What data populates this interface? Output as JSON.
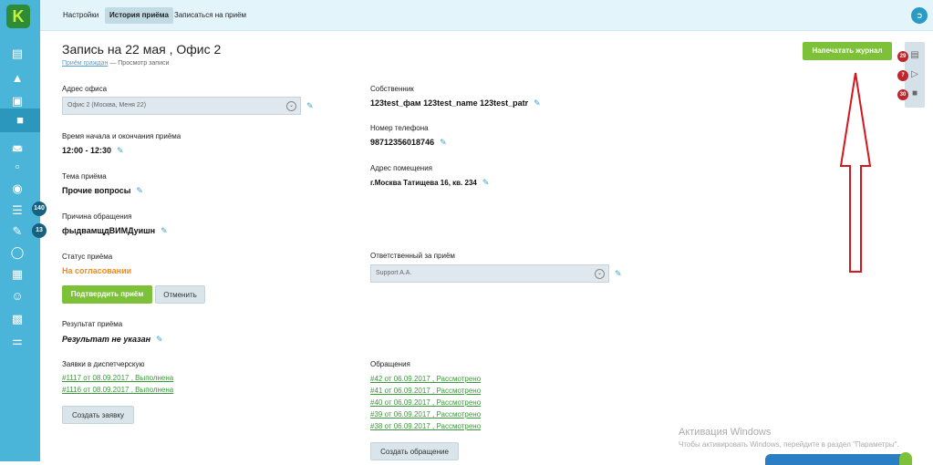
{
  "logo": "K",
  "colors": {
    "sidebar": "#4ab5d9",
    "accent_green": "#7cc137",
    "status_orange": "#f08a1e",
    "badge_red": "#c0252b"
  },
  "sidebar": {
    "icons": [
      "chart-icon",
      "landscape-icon",
      "wallet-icon",
      "stamp-icon",
      "bookmark-icon",
      "archive-icon",
      "coin-icon",
      "tray-icon",
      "edit-icon",
      "chat-icon",
      "building-icon",
      "smile-icon",
      "newspaper-icon",
      "sliders-icon"
    ],
    "badges": {
      "tray": "140",
      "edit": "13"
    }
  },
  "topnav": {
    "tabs": [
      "Настройки",
      "История приёма",
      "Записаться на приём"
    ],
    "active_tab": "История приёма"
  },
  "page": {
    "title": "Запись на 22 мая , Офис 2",
    "breadcrumb": {
      "link": "Приём граждан",
      "separator": "—",
      "current": "Просмотр записи"
    },
    "print_button": "Напечатать журнал"
  },
  "right_panel": {
    "badges": [
      "29",
      "7",
      "30"
    ]
  },
  "form": {
    "office_address_label": "Адрес офиса",
    "office_address_value": "Офис 2 (Москва, Меня 22)",
    "time_label": "Время начала и окончания приёма",
    "time_value": "12:00 - 12:30",
    "topic_label": "Тема приёма",
    "topic_value": "Прочие вопросы",
    "reason_label": "Причина обращения",
    "reason_value": "фыдвамщдВИМДуишн",
    "status_label": "Статус приёма",
    "status_value": "На согласовании",
    "confirm_button": "Подтвердить приём",
    "cancel_button": "Отменить",
    "result_label": "Результат приёма",
    "result_value": "Результат не указан",
    "owner_label": "Собственник",
    "owner_value": "123test_фам 123test_name 123test_patr",
    "phone_label": "Номер телефона",
    "phone_value": "98712356018746",
    "premises_label": "Адрес помещения",
    "premises_value": "г.Москва Татищева 16, кв. 234",
    "responsible_label": "Ответственный за приём",
    "responsible_value": "Support A.A."
  },
  "dispatch": {
    "label": "Заявки в диспетчерскую",
    "items": [
      "#1117 от 08.09.2017 , Выполнена",
      "#1116 от 08.09.2017 , Выполнена"
    ],
    "create_button": "Создать заявку"
  },
  "appeals": {
    "label": "Обращения",
    "items": [
      "#42 от 06.09.2017 , Рассмотрено",
      "#41 от 06.09.2017 , Рассмотрено",
      "#40 от 06.09.2017 , Рассмотрено",
      "#39 от 06.09.2017 , Рассмотрено",
      "#38 от 06.09.2017 , Рассмотрено"
    ],
    "create_button": "Создать обращение"
  },
  "watermark": {
    "line1": "Активация Windows",
    "line2": "Чтобы активировать Windows, перейдите в раздел \"Параметры\"."
  }
}
